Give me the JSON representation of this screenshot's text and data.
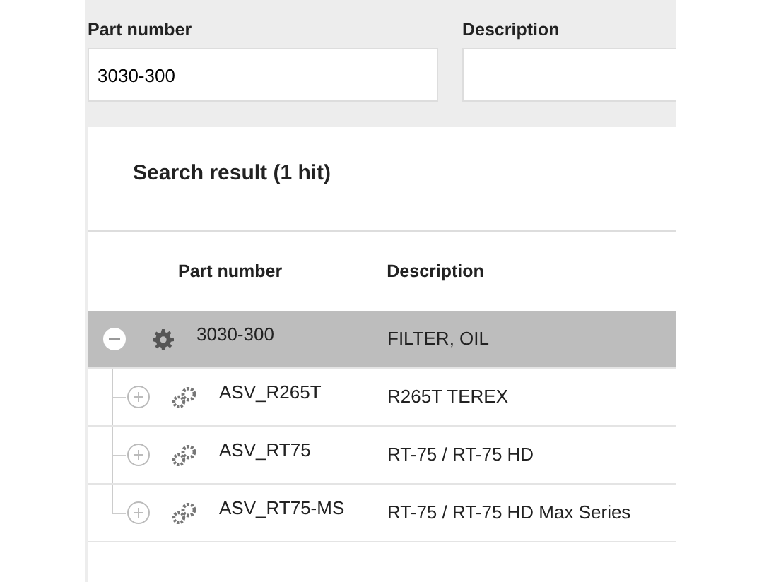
{
  "filters": [
    {
      "label": "Part number",
      "value": "3030-300"
    },
    {
      "label": "Description"
    }
  ],
  "result": {
    "title": "Search result (1 hit)",
    "columns": [
      "Part number",
      "Description"
    ],
    "rows": [
      {
        "part": "3030-300",
        "description": "FILTER, OIL",
        "expanded": true,
        "selected": true,
        "kind": "part",
        "children": [
          {
            "part": "ASV_R265T",
            "description": "R265T TEREX",
            "expanded": false,
            "selected": false,
            "kind": "assembly"
          },
          {
            "part": "ASV_RT75",
            "description": "RT-75 / RT-75 HD",
            "expanded": false,
            "selected": false,
            "kind": "assembly"
          },
          {
            "part": "ASV_RT75-MS",
            "description": "RT-75 / RT-75 HD Max Series",
            "expanded": false,
            "selected": false,
            "kind": "assembly"
          }
        ]
      }
    ]
  }
}
